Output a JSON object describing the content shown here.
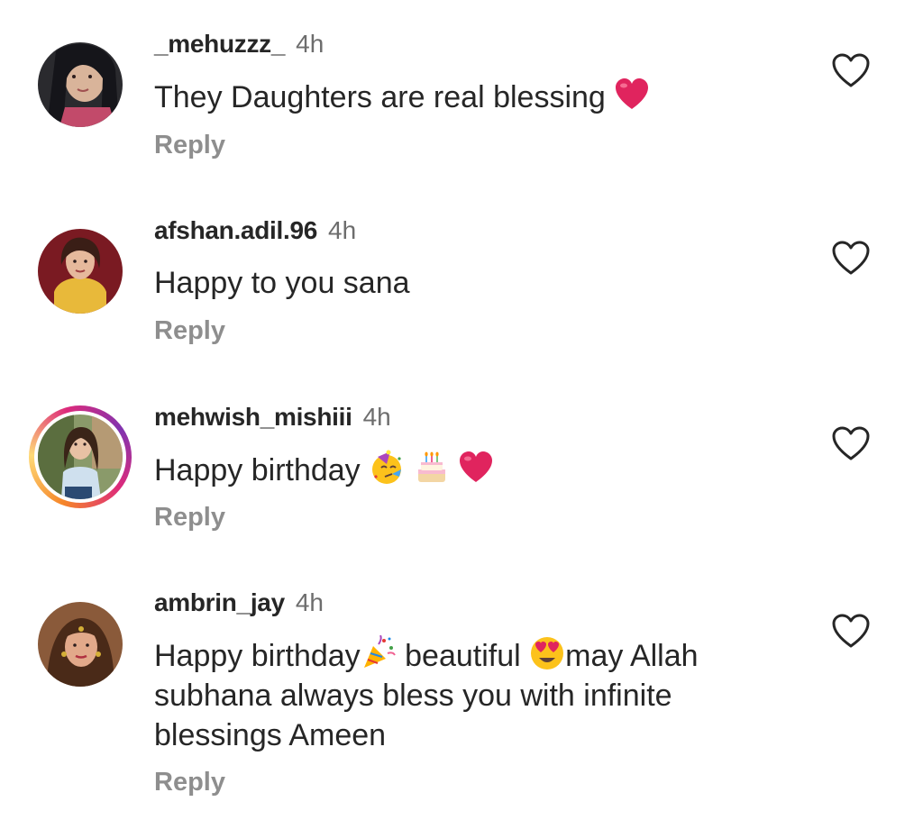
{
  "comments": [
    {
      "username": "_mehuzzz_",
      "time": "4h",
      "text": "They Daughters are real blessing",
      "emojis": [
        "red-heart"
      ],
      "reply_label": "Reply",
      "has_story_ring": false
    },
    {
      "username": "afshan.adil.96",
      "time": "4h",
      "text": "Happy to you sana",
      "emojis": [],
      "reply_label": "Reply",
      "has_story_ring": false
    },
    {
      "username": "mehwish_mishiii",
      "time": "4h",
      "text": "Happy birthday",
      "emojis": [
        "partying-face",
        "birthday-cake",
        "red-heart"
      ],
      "reply_label": "Reply",
      "has_story_ring": true
    },
    {
      "username": "ambrin_jay",
      "time": "4h",
      "text_part1": "Happy birthday",
      "emoji1": "party-popper",
      "text_part2": " beautiful ",
      "emoji2": "heart-eyes",
      "text_part3": "may Allah",
      "text_line2": "subhana always bless you with infinite",
      "text_line3": "blessings Ameen",
      "reply_label": "Reply",
      "has_story_ring": false
    }
  ],
  "colors": {
    "username": "#262626",
    "meta": "#6d6d6d",
    "reply": "#8e8e8e",
    "heart_outline": "#262626",
    "emoji_heart": "#e0245e"
  }
}
